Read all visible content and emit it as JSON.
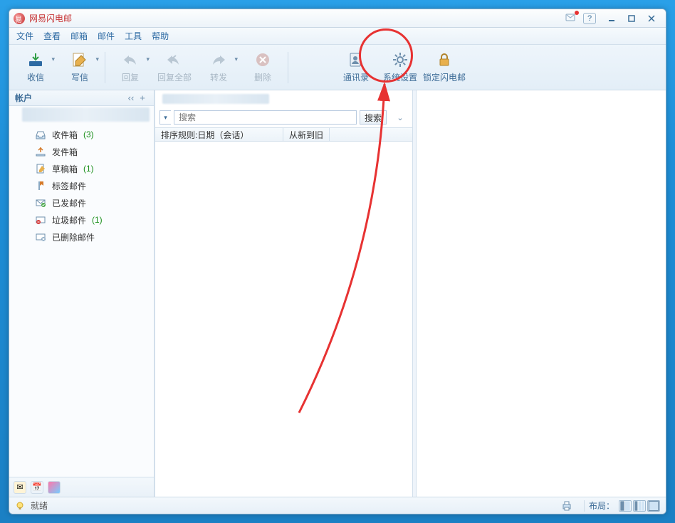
{
  "app": {
    "title": "网易闪电邮"
  },
  "menu": {
    "file": "文件",
    "view": "查看",
    "mailbox": "邮箱",
    "mail": "邮件",
    "tools": "工具",
    "help": "帮助"
  },
  "toolbar": {
    "receive": "收信",
    "compose": "写信",
    "reply": "回复",
    "reply_all": "回复全部",
    "forward": "转发",
    "delete": "删除",
    "contacts": "通讯录",
    "settings": "系统设置",
    "lock": "锁定闪电邮"
  },
  "sidebar": {
    "account_label": "帐户",
    "folders": [
      {
        "name": "收件箱",
        "count": "(3)",
        "icon": "inbox"
      },
      {
        "name": "发件箱",
        "count": "",
        "icon": "outbox"
      },
      {
        "name": "草稿箱",
        "count": "(1)",
        "icon": "draft"
      },
      {
        "name": "标签邮件",
        "count": "",
        "icon": "tag"
      },
      {
        "name": "已发邮件",
        "count": "",
        "icon": "sent"
      },
      {
        "name": "垃圾邮件",
        "count": "(1)",
        "icon": "spam"
      },
      {
        "name": "已删除邮件",
        "count": "",
        "icon": "trash"
      }
    ]
  },
  "search": {
    "placeholder": "搜索",
    "button": "搜索"
  },
  "sort": {
    "rule": "排序规则:日期（会话）",
    "order": "从新到旧"
  },
  "status": {
    "ready": "就绪",
    "layout": "布局："
  }
}
